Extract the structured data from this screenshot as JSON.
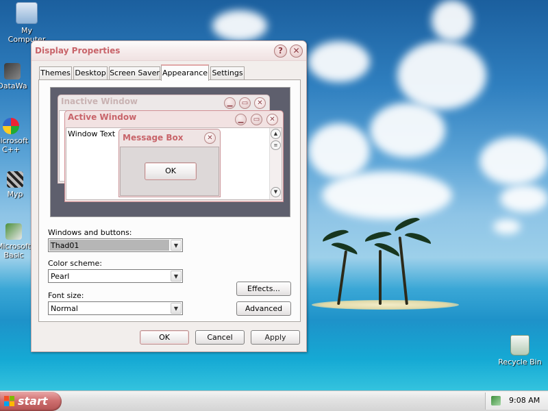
{
  "desktop": {
    "icons": [
      {
        "label": "My Computer",
        "icon": "my-computer-icon"
      },
      {
        "label": "DataWa",
        "icon": "shortcut-icon"
      },
      {
        "label": "Microsoft C++",
        "icon": "visual-cpp-icon"
      },
      {
        "label": "Myp",
        "icon": "shortcut-icon"
      },
      {
        "label": "Microsoft Basic",
        "icon": "visual-basic-icon"
      },
      {
        "label": "Recycle Bin",
        "icon": "recycle-bin-icon"
      }
    ]
  },
  "dialog": {
    "title": "Display Properties",
    "help_glyph": "?",
    "close_glyph": "✕",
    "tabs": [
      "Themes",
      "Desktop",
      "Screen Saver",
      "Appearance",
      "Settings"
    ],
    "active_tab": "Appearance",
    "preview": {
      "inactive_title": "Inactive Window",
      "active_title": "Active Window",
      "window_text": "Window Text",
      "message_box_title": "Message Box",
      "message_box_ok": "OK"
    },
    "windows_and_buttons": {
      "label": "Windows and buttons:",
      "value": "Thad01"
    },
    "color_scheme": {
      "label": "Color scheme:",
      "value": "Pearl"
    },
    "font_size": {
      "label": "Font size:",
      "value": "Normal"
    },
    "effects_label": "Effects...",
    "advanced_label": "Advanced",
    "ok_label": "OK",
    "cancel_label": "Cancel",
    "apply_label": "Apply"
  },
  "taskbar": {
    "start_label": "start",
    "clock": "9:08 AM"
  },
  "colors": {
    "title_text": "#c8646a",
    "accent": "#e0a6a6",
    "start_button": "#cf7070"
  }
}
